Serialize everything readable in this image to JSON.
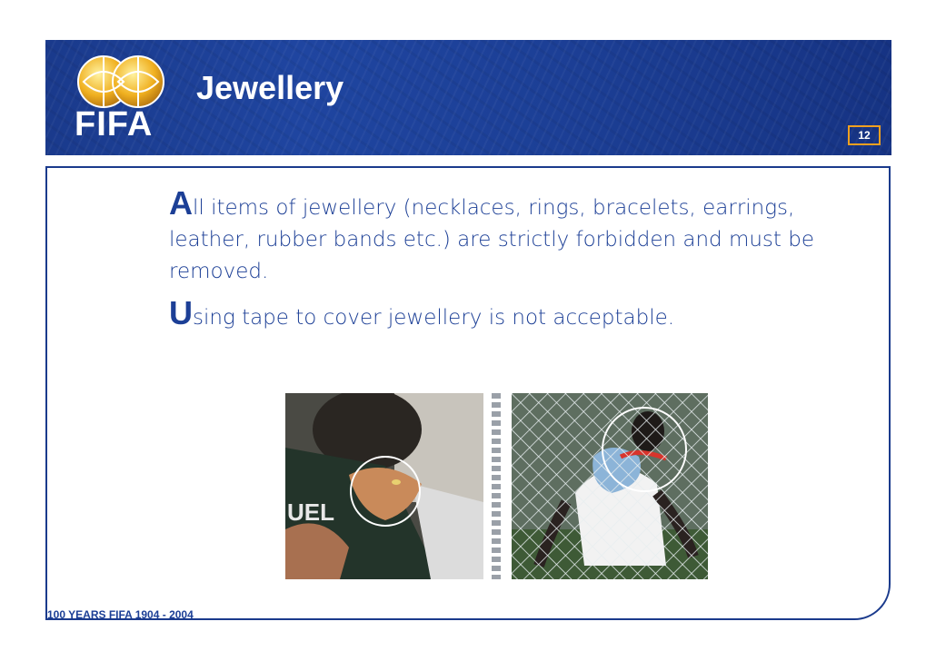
{
  "header": {
    "title": "Jewellery",
    "logo_text": "FIFA",
    "page_number": "12"
  },
  "bullets": [
    {
      "cap": "A",
      "rest": "ll items of jewellery (necklaces, rings, bracelets, earrings, leather, rubber bands etc.) are strictly forbidden and must be removed."
    },
    {
      "cap": "U",
      "rest": "sing tape to cover jewellery is not acceptable."
    }
  ],
  "footer": {
    "text": "100 YEARS FIFA  1904 - 2004"
  },
  "colors": {
    "header_blue": "#1c3f96",
    "text_blue": "#1c3f96",
    "page_box_orange": "#f0a020"
  }
}
